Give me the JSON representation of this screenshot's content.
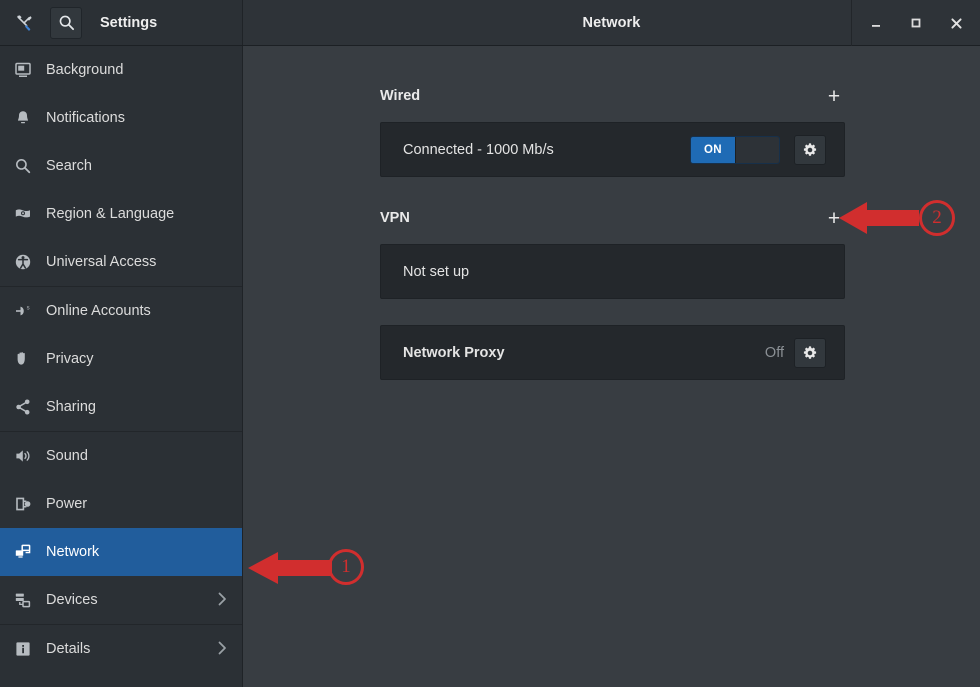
{
  "window": {
    "app_title": "Settings",
    "title": "Network",
    "controls": {
      "minimize": "minimize-icon",
      "maximize": "maximize-icon",
      "close": "close-icon"
    },
    "header_icons": {
      "tools": "tools-icon",
      "search": "search-icon"
    }
  },
  "sidebar": {
    "items": [
      {
        "label": "Background",
        "icon": "display-picture-icon",
        "selected": false,
        "chevron": false
      },
      {
        "label": "Notifications",
        "icon": "bell-icon",
        "selected": false,
        "chevron": false
      },
      {
        "label": "Search",
        "icon": "search-icon",
        "selected": false,
        "chevron": false
      },
      {
        "label": "Region & Language",
        "icon": "flag-language-icon",
        "selected": false,
        "chevron": false
      },
      {
        "label": "Universal Access",
        "icon": "accessibility-icon",
        "selected": false,
        "chevron": false
      },
      {
        "label": "Online Accounts",
        "icon": "online-accounts-icon",
        "selected": false,
        "chevron": false
      },
      {
        "label": "Privacy",
        "icon": "hand-privacy-icon",
        "selected": false,
        "chevron": false
      },
      {
        "label": "Sharing",
        "icon": "share-nodes-icon",
        "selected": false,
        "chevron": false
      },
      {
        "label": "Sound",
        "icon": "speaker-icon",
        "selected": false,
        "chevron": false
      },
      {
        "label": "Power",
        "icon": "power-plug-icon",
        "selected": false,
        "chevron": false
      },
      {
        "label": "Network",
        "icon": "network-icon",
        "selected": true,
        "chevron": false
      },
      {
        "label": "Devices",
        "icon": "devices-icon",
        "selected": false,
        "chevron": true
      },
      {
        "label": "Details",
        "icon": "info-icon",
        "selected": false,
        "chevron": true
      }
    ],
    "separator_after_indices": [
      4,
      7,
      11
    ]
  },
  "main": {
    "sections": [
      {
        "title": "Wired",
        "add_label": "+",
        "row": {
          "label": "Connected - 1000 Mb/s",
          "toggle_state": "ON",
          "toggle_on": true,
          "settings_icon": "gear-icon"
        }
      },
      {
        "title": "VPN",
        "add_label": "+",
        "row": {
          "label": "Not set up",
          "toggle_state": null,
          "toggle_on": false,
          "settings_icon": null
        }
      }
    ],
    "proxy": {
      "label": "Network Proxy",
      "state": "Off",
      "settings_icon": "gear-icon"
    }
  },
  "annotations": {
    "color": "#d12e2e",
    "markers": [
      {
        "number": "1",
        "target": "sidebar-item-network"
      },
      {
        "number": "2",
        "target": "vpn-add-button"
      }
    ]
  }
}
